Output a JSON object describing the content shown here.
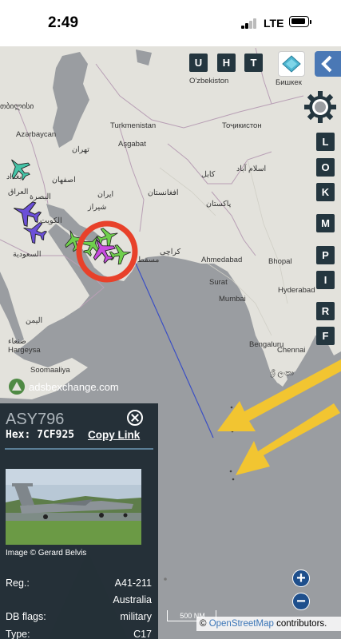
{
  "status_bar": {
    "time": "2:49",
    "network": "LTE"
  },
  "map": {
    "top_buttons": [
      "U",
      "H",
      "T"
    ],
    "side_buttons": [
      "L",
      "O",
      "K",
      "M",
      "P",
      "I",
      "R",
      "F"
    ],
    "places": [
      {
        "id": "uzbekistan",
        "text": "O'zbekiston"
      },
      {
        "id": "bishkek",
        "text": "Бишкек"
      },
      {
        "id": "tbilisi",
        "text": "თბილისი"
      },
      {
        "id": "azerbaycan",
        "text": "Azərbaycan"
      },
      {
        "id": "turkmenistan",
        "text": "Turkmenistan"
      },
      {
        "id": "tojikiston",
        "text": "Тоҷикистон"
      },
      {
        "id": "asgabat",
        "text": "Aşgabat"
      },
      {
        "id": "tehran",
        "text": "تهران"
      },
      {
        "id": "kabul",
        "text": "کابل"
      },
      {
        "id": "islamabad",
        "text": "اسلام آباد"
      },
      {
        "id": "afghanistan",
        "text": "افغانستان"
      },
      {
        "id": "iran",
        "text": "ایران"
      },
      {
        "id": "baghdad",
        "text": "بغداد"
      },
      {
        "id": "isfahan",
        "text": "اصفهان"
      },
      {
        "id": "pakistan",
        "text": "پاکستان"
      },
      {
        "id": "iraq",
        "text": "العراق"
      },
      {
        "id": "basra",
        "text": "البصرة"
      },
      {
        "id": "shiraz",
        "text": "شیراز"
      },
      {
        "id": "kuwait",
        "text": "الكويت"
      },
      {
        "id": "saudi",
        "text": "السعودية"
      },
      {
        "id": "karachi",
        "text": "کراچی"
      },
      {
        "id": "ahmedabad",
        "text": "Ahmedabad"
      },
      {
        "id": "bhopal",
        "text": "Bhopal"
      },
      {
        "id": "muscat",
        "text": "مسقط"
      },
      {
        "id": "surat",
        "text": "Surat"
      },
      {
        "id": "mumbai",
        "text": "Mumbai"
      },
      {
        "id": "hyderabad",
        "text": "Hyderabad"
      },
      {
        "id": "yemen",
        "text": "اليمن"
      },
      {
        "id": "sanaa",
        "text": "صنعاء"
      },
      {
        "id": "bengaluru",
        "text": "Bengaluru"
      },
      {
        "id": "chennai",
        "text": "Chennai"
      },
      {
        "id": "hargeysa",
        "text": "Hargeysa"
      },
      {
        "id": "soomaaliya",
        "text": "Soomaaliya"
      },
      {
        "id": "colombo",
        "text": "ශ්‍රී ලංකා"
      }
    ],
    "logo_text": "adsbexchange.com",
    "scale": "500 NM",
    "attribution_link": "OpenStreetMap",
    "attribution_rest": " contributors.",
    "attribution_symbol": "©",
    "colors": {
      "track": "#3b4fc4",
      "highlight_circle": "#e8412a",
      "arrow": "#f2c531"
    }
  },
  "aircraft_panel": {
    "callsign": "ASY796",
    "hex_label": "Hex:",
    "hex": "7CF925",
    "copy_link": "Copy Link",
    "photo_credit": "Image © Gerard Belvis",
    "rows": [
      {
        "label": "Reg.:",
        "value": "A41-211"
      },
      {
        "label": "",
        "value": "Australia"
      },
      {
        "label": "DB flags:",
        "value": "military"
      },
      {
        "label": "Type:",
        "value": "C17"
      }
    ]
  }
}
